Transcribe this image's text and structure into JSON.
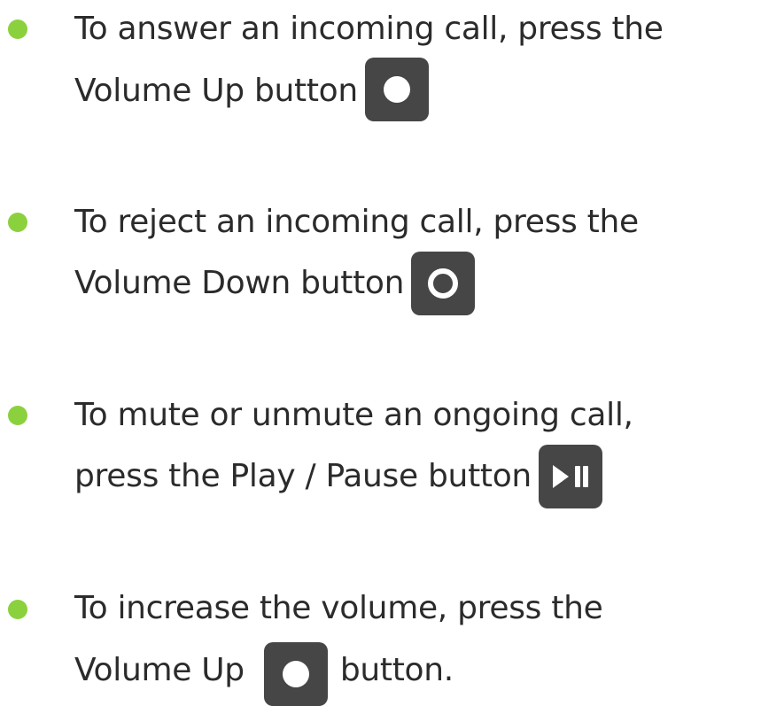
{
  "bullet_color": "#8bd13e",
  "button_color": "#464646",
  "items": [
    {
      "line1": "To answer an incoming call, press the",
      "line2": "Volume Up button",
      "icon": "filled-circle-icon"
    },
    {
      "line1": "To reject an incoming call, press the",
      "line2": "Volume Down button",
      "icon": "ring-circle-icon"
    },
    {
      "line1": "To mute or unmute an ongoing call,",
      "line2": "press the Play / Pause button",
      "icon": "play-pause-icon"
    },
    {
      "line1": "To increase the volume, press the",
      "line2": "Volume Up",
      "line2_after": "button.",
      "icon": "filled-circle-icon"
    }
  ]
}
